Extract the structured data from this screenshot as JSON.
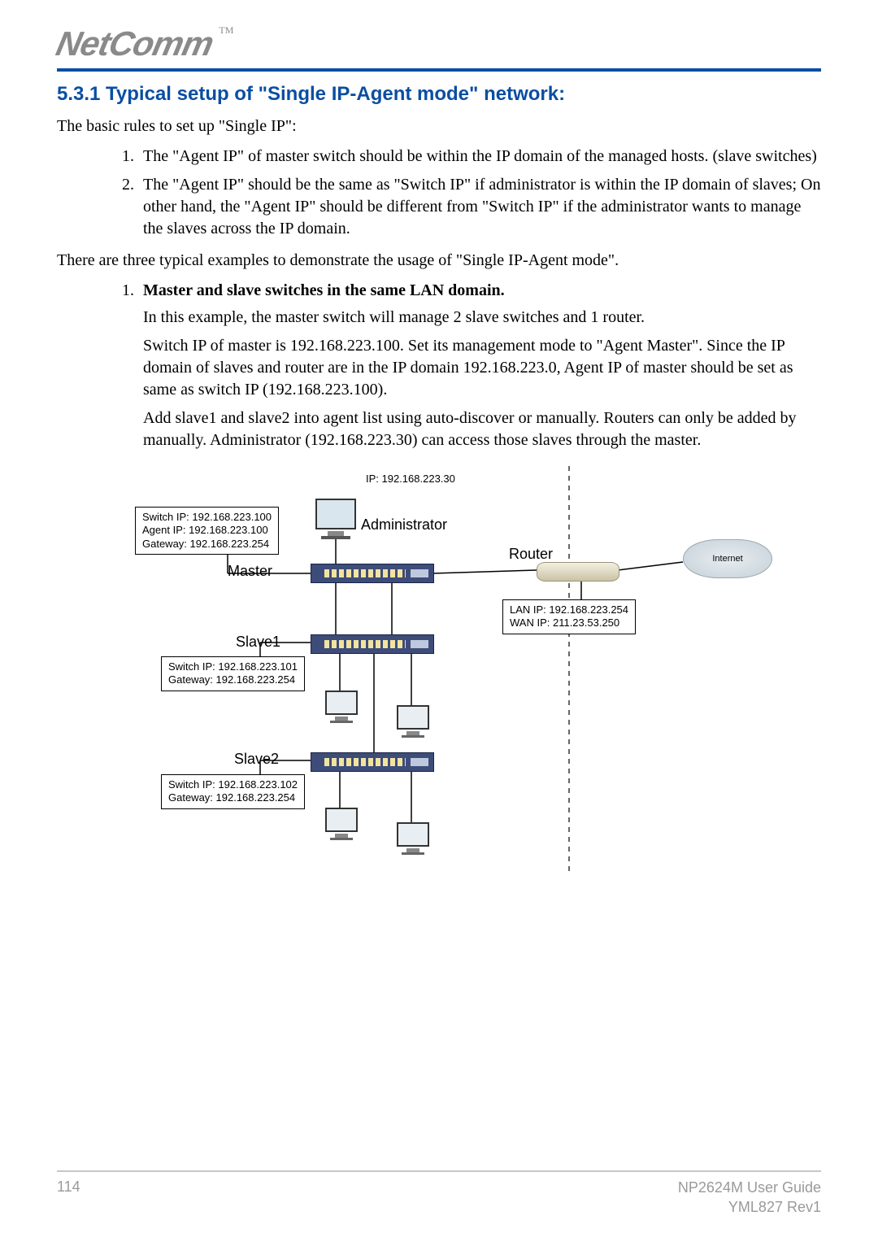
{
  "logo": {
    "text": "NetComm",
    "tm": "TM"
  },
  "section": {
    "title": "5.3.1 Typical setup of \"Single IP-Agent mode\" network:",
    "intro": "The basic rules to set up \"Single IP\":",
    "rule1": "The \"Agent IP\" of master switch should be within the IP domain of the managed hosts. (slave switches)",
    "rule2": "The \"Agent IP\" should be the same as \"Switch IP\" if administrator is within the IP domain of slaves; On other hand, the \"Agent IP\" should be different from \"Switch IP\" if the administrator wants to manage the slaves across the IP domain.",
    "three_examples_intro": "There are three typical examples to demonstrate the usage of \"Single IP-Agent mode\"."
  },
  "example1": {
    "title": "Master and slave switches in the same LAN domain.",
    "p1": "In this example, the master switch will manage 2 slave switches and 1 router.",
    "p2": "Switch IP of master is 192.168.223.100.  Set its management mode to \"Agent Master\". Since the IP domain of slaves and router are in the IP domain 192.168.223.0, Agent IP of master should be set as same as switch IP (192.168.223.100).",
    "p3": "Add slave1 and slave2 into agent list using auto-discover or manually.  Routers can only be added by manually.  Administrator (192.168.223.30) can access those slaves through the master."
  },
  "diagram": {
    "admin_ip": "IP: 192.168.223.30",
    "administrator": "Administrator",
    "master_label": "Master",
    "slave1_label": "Slave1",
    "slave2_label": "Slave2",
    "router_label": "Router",
    "internet_label": "Internet",
    "master_info_l1": "Switch IP: 192.168.223.100",
    "master_info_l2": "Agent IP: 192.168.223.100",
    "master_info_l3": "Gateway: 192.168.223.254",
    "slave1_info_l1": "Switch IP: 192.168.223.101",
    "slave1_info_l2": "Gateway: 192.168.223.254",
    "slave2_info_l1": "Switch IP: 192.168.223.102",
    "slave2_info_l2": "Gateway: 192.168.223.254",
    "router_info_l1": "LAN IP: 192.168.223.254",
    "router_info_l2": "WAN IP: 211.23.53.250"
  },
  "footer": {
    "page": "114",
    "guide": "NP2624M User Guide",
    "rev": "YML827 Rev1"
  }
}
